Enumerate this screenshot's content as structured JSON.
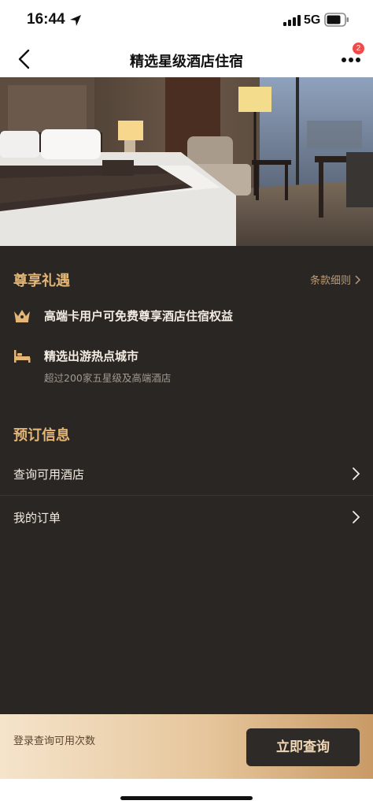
{
  "status_bar": {
    "time": "16:44",
    "network": "5G",
    "icons": [
      "location-arrow-icon",
      "signal-icon",
      "battery-icon"
    ]
  },
  "nav": {
    "title": "精选星级酒店住宿",
    "back_icon": "chevron-left-icon",
    "more_icon": "more-dots-icon",
    "badge_count": "2"
  },
  "hero": {
    "icon": "hotel-room-photo"
  },
  "privileges": {
    "title": "尊享礼遇",
    "terms_link": "条款细则",
    "items": [
      {
        "icon": "crown-icon",
        "title": "高端卡用户可免费尊享酒店住宿权益"
      },
      {
        "icon": "bed-icon",
        "title": "精选出游热点城市",
        "subtitle": "超过200家五星级及高端酒店"
      }
    ]
  },
  "booking": {
    "title": "预订信息",
    "rows": [
      {
        "label": "查询可用酒店"
      },
      {
        "label": "我的订单"
      }
    ]
  },
  "bottom_bar": {
    "hint": "登录查询可用次数",
    "button_label": "立即查询"
  },
  "colors": {
    "background": "#2a2623",
    "accent_gold": "#e3b678",
    "text_light": "#f4ece2",
    "button_bg": "#2d2a27",
    "badge_red": "#f04a4a"
  }
}
